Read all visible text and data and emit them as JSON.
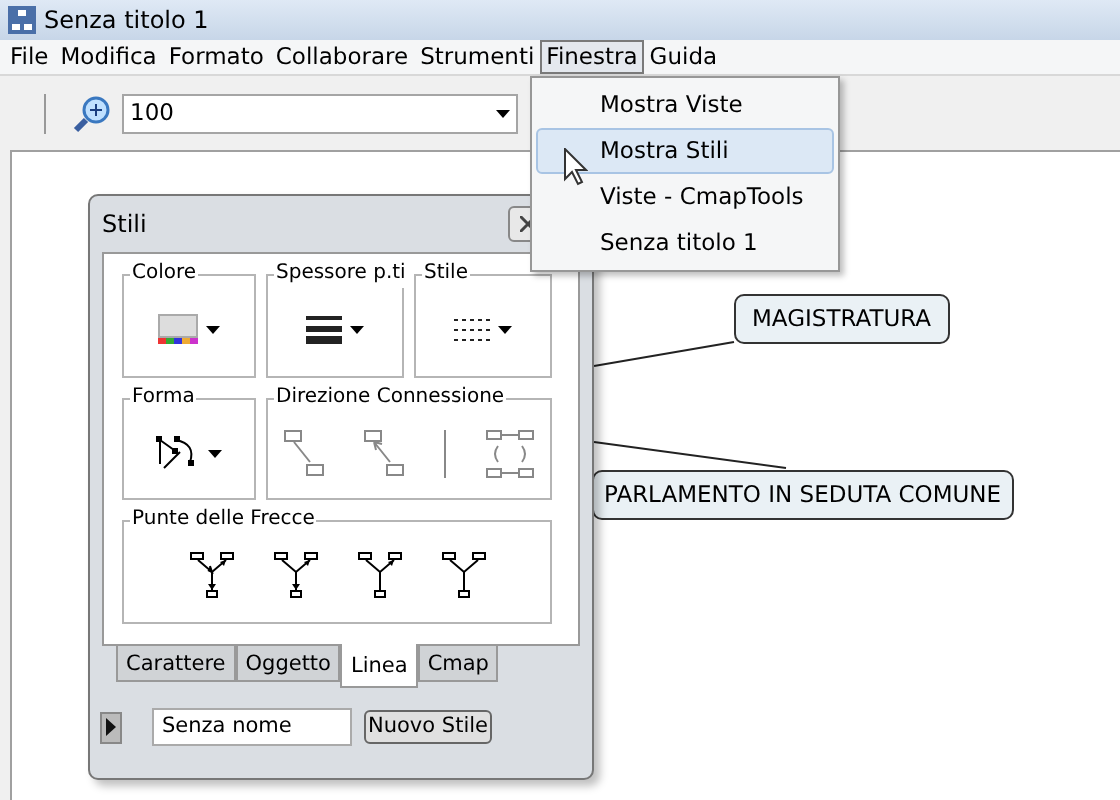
{
  "window": {
    "title": "Senza titolo 1"
  },
  "menu_bar": [
    {
      "label": "File",
      "selected": false
    },
    {
      "label": "Modifica",
      "selected": false
    },
    {
      "label": "Formato",
      "selected": false
    },
    {
      "label": "Collaborare",
      "selected": false
    },
    {
      "label": "Strumenti",
      "selected": false
    },
    {
      "label": "Finestra",
      "selected": true
    },
    {
      "label": "Guida",
      "selected": false
    }
  ],
  "toolbar": {
    "zoom": "100"
  },
  "menu": [
    {
      "label": "Mostra Viste",
      "selected": false
    },
    {
      "label": "Mostra Stili",
      "selected": true
    },
    {
      "label": "Viste - CmapTools",
      "selected": false
    },
    {
      "label": "Senza titolo 1",
      "selected": false
    }
  ],
  "palette": {
    "title": "Stili",
    "groups": [
      {
        "label": "Colore",
        "kind": "color"
      },
      {
        "label": "Spessore p.ti",
        "kind": "thickness"
      },
      {
        "label": "Stile",
        "kind": "style"
      },
      {
        "label": "Forma",
        "kind": "shape"
      },
      {
        "label": "Direzione Connessione",
        "kind": "direction"
      },
      {
        "label": "Punte delle Frecce",
        "kind": "arrows"
      }
    ],
    "tabs": [
      {
        "label": "Carattere",
        "selected": false
      },
      {
        "label": "Oggetto",
        "selected": false
      },
      {
        "label": "Linea",
        "selected": true
      },
      {
        "label": "Cmap",
        "selected": false
      }
    ],
    "style_name": "Senza nome",
    "new_style_button": "Nuovo Stile"
  },
  "nodes": [
    {
      "label": "MAGISTRATURA"
    },
    {
      "label": "PARLAMENTO IN SEDUTA COMUNE"
    }
  ]
}
